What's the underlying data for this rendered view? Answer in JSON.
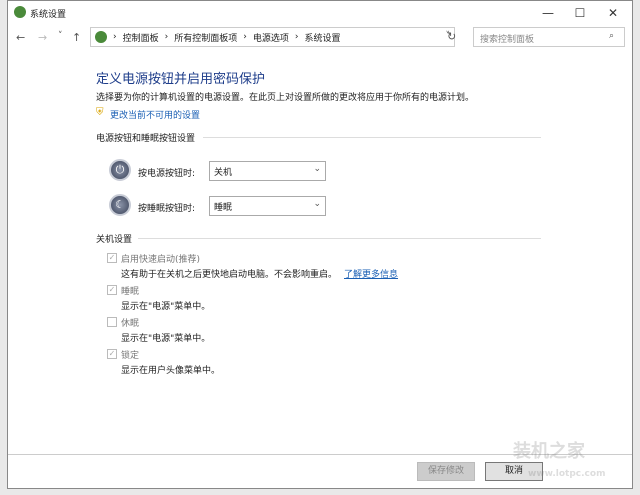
{
  "window": {
    "title": "系统设置",
    "minimize": "—",
    "maximize": "☐",
    "close": "✕"
  },
  "nav": {
    "back": "←",
    "forward": "→",
    "recent": "˅",
    "up": "↑",
    "refresh": "↻",
    "dropdown": "˅"
  },
  "breadcrumb": [
    "控制面板",
    "所有控制面板项",
    "电源选项",
    "系统设置"
  ],
  "search": {
    "placeholder": "搜索控制面板"
  },
  "page": {
    "heading": "定义电源按钮并启用密码保护",
    "description": "选择要为你的计算机设置的电源设置。在此页上对设置所做的更改将应用于你所有的电源计划。",
    "change_link": "更改当前不可用的设置"
  },
  "button_section": {
    "title": "电源按钮和睡眠按钮设置",
    "power_label": "按电源按钮时:",
    "power_value": "关机",
    "sleep_label": "按睡眠按钮时:",
    "sleep_value": "睡眠"
  },
  "shutdown_section": {
    "title": "关机设置",
    "items": [
      {
        "label": "启用快速启动(推荐)",
        "checked": true,
        "desc": "这有助于在关机之后更快地启动电脑。不会影响重启。",
        "link": "了解更多信息"
      },
      {
        "label": "睡眠",
        "checked": true,
        "desc": "显示在\"电源\"菜单中。"
      },
      {
        "label": "休眠",
        "checked": false,
        "desc": "显示在\"电源\"菜单中。"
      },
      {
        "label": "锁定",
        "checked": true,
        "desc": "显示在用户头像菜单中。"
      }
    ]
  },
  "footer": {
    "save": "保存修改",
    "cancel": "取消"
  },
  "watermark": {
    "name": "装机之家",
    "url": "www.lotpc.com"
  }
}
